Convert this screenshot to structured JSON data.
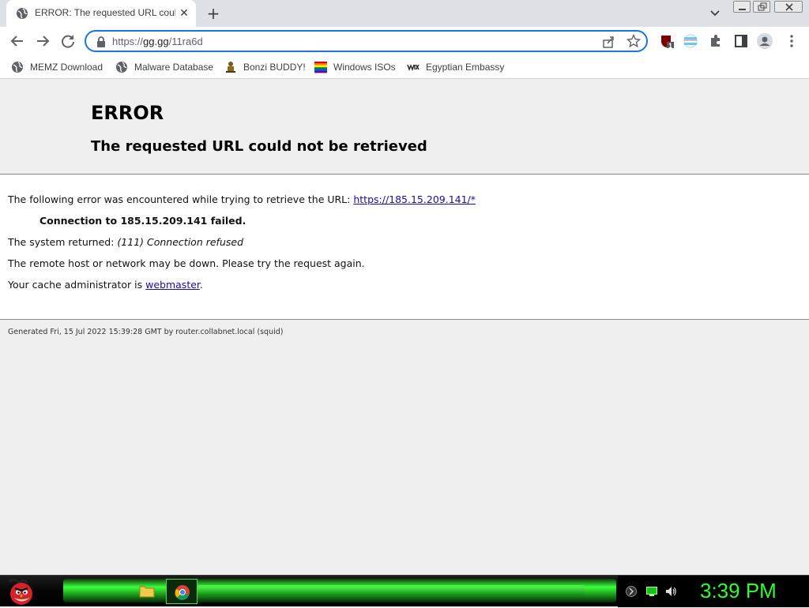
{
  "browser": {
    "tab": {
      "title": "ERROR: The requested URL could not be retrieved",
      "close_glyph": "✕"
    },
    "new_tab_glyph": "+",
    "omnibox": {
      "scheme": "https://",
      "host": "gg.gg",
      "path": "/11ra6d"
    },
    "bookmarks": [
      {
        "label": "MEMZ Download",
        "icon": "globe-icon"
      },
      {
        "label": "Malware Database",
        "icon": "globe-icon"
      },
      {
        "label": "Bonzi BUDDY!",
        "icon": "bonzi-icon"
      },
      {
        "label": "Windows ISOs",
        "icon": "windows-flag-icon"
      },
      {
        "label": "Egyptian Embassy",
        "icon": "wix-icon"
      }
    ],
    "extensions": {
      "ublock_badge": "1"
    }
  },
  "page": {
    "title": "ERROR",
    "subtitle": "The requested URL could not be retrieved",
    "line1_text": "The following error was encountered while trying to retrieve the URL: ",
    "line1_link": "https://185.15.209.141/*",
    "line2": "Connection to 185.15.209.141 failed.",
    "line3_text": "The system returned: ",
    "line3_error": "(111) Connection refused",
    "line4": "The remote host or network may be down. Please try the request again.",
    "line5_text": "Your cache administrator is ",
    "line5_link": "webmaster",
    "line5_end": ".",
    "footer": "Generated Fri, 15 Jul 2022 15:39:28 GMT by router.collabnet.local (squid)"
  },
  "taskbar": {
    "clock": "3:39 PM",
    "accent": "#2bff2b"
  },
  "colors": {
    "link": "#1a0dab",
    "omnibox_focus": "#1a73e8",
    "tab_strip": "#dee1e6"
  }
}
